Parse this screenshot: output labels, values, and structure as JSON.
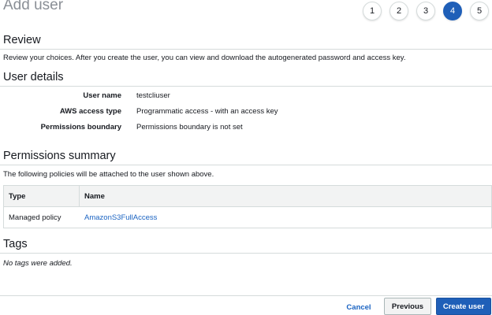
{
  "header": {
    "title": "Add user",
    "steps": [
      "1",
      "2",
      "3",
      "4",
      "5"
    ]
  },
  "review": {
    "title": "Review",
    "description": "Review your choices. After you create the user, you can view and download the autogenerated password and access key."
  },
  "user_details": {
    "title": "User details",
    "rows": [
      {
        "key": "User name",
        "value": "testcliuser"
      },
      {
        "key": "AWS access type",
        "value": "Programmatic access - with an access key"
      },
      {
        "key": "Permissions boundary",
        "value": "Permissions boundary is not set"
      }
    ]
  },
  "permissions": {
    "title": "Permissions summary",
    "description": "The following policies will be attached to the user shown above.",
    "columns": [
      "Type",
      "Name"
    ],
    "rows": [
      {
        "type": "Managed policy",
        "name": "AmazonS3FullAccess"
      }
    ]
  },
  "tags": {
    "title": "Tags",
    "empty": "No tags were added."
  },
  "footer": {
    "cancel": "Cancel",
    "previous": "Previous",
    "create": "Create user"
  },
  "colors": {
    "accent": "#1f5fb8",
    "link": "#1a63c2"
  }
}
